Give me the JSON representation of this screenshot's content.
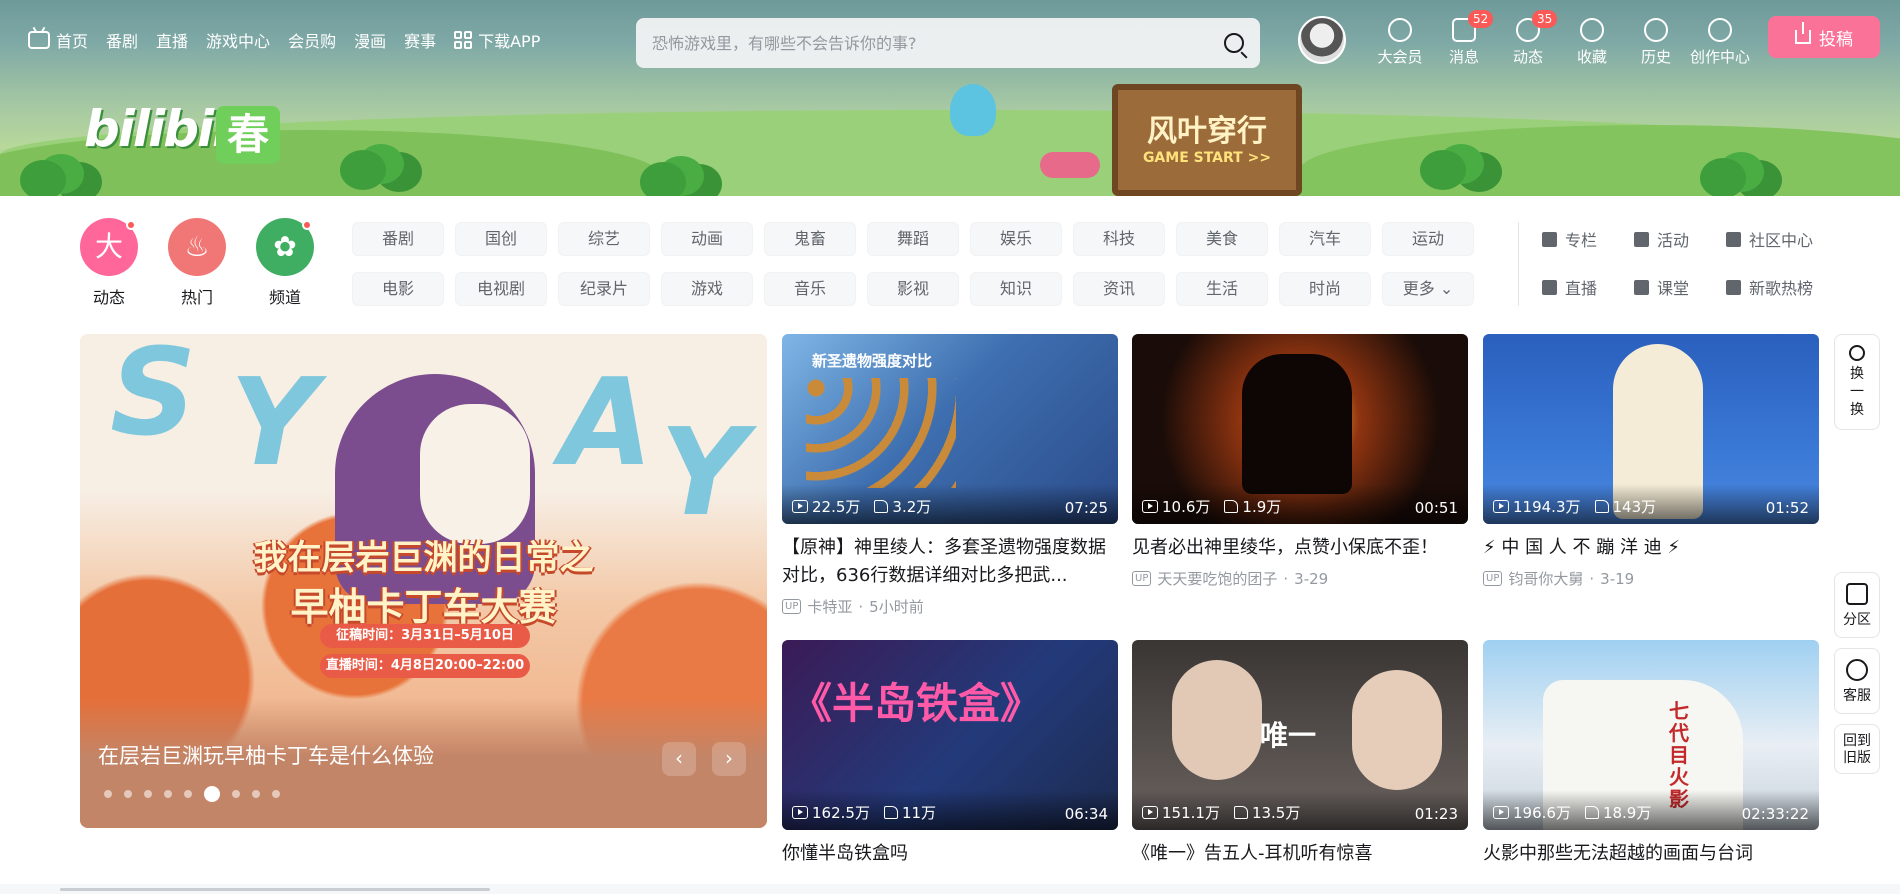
{
  "nav": {
    "left": [
      "首页",
      "番剧",
      "直播",
      "游戏中心",
      "会员购",
      "漫画",
      "赛事",
      "下载APP"
    ],
    "search_placeholder": "恐怖游戏里，有哪些不会告诉你的事?",
    "right": [
      {
        "label": "大会员",
        "icon": "vip-icon",
        "badge": ""
      },
      {
        "label": "消息",
        "icon": "message-icon",
        "badge": "52"
      },
      {
        "label": "动态",
        "icon": "dynamic-icon",
        "badge": "35"
      },
      {
        "label": "收藏",
        "icon": "star-icon",
        "badge": ""
      },
      {
        "label": "历史",
        "icon": "clock-icon",
        "badge": ""
      },
      {
        "label": "创作中心",
        "icon": "bulb-icon",
        "badge": ""
      }
    ],
    "upload": "投稿"
  },
  "banner": {
    "logo": "bilibili",
    "logo_badge": "春",
    "sign_title": "风叶穿行",
    "sign_sub": "GAME START >>"
  },
  "channels": {
    "big": [
      {
        "label": "动态",
        "glyph": "大",
        "color": "#ff6699",
        "dot": true
      },
      {
        "label": "热门",
        "glyph": "♨",
        "color": "#f07775",
        "dot": false
      },
      {
        "label": "频道",
        "glyph": "✿",
        "color": "#40ae62",
        "dot": true
      }
    ],
    "tags": [
      "番剧",
      "国创",
      "综艺",
      "动画",
      "鬼畜",
      "舞蹈",
      "娱乐",
      "科技",
      "美食",
      "汽车",
      "运动",
      "电影",
      "电视剧",
      "纪录片",
      "游戏",
      "音乐",
      "影视",
      "知识",
      "资讯",
      "生活",
      "时尚",
      "更多 ⌄"
    ],
    "links": [
      "专栏",
      "活动",
      "社区中心",
      "直播",
      "课堂",
      "新歌热榜"
    ]
  },
  "carousel": {
    "headline1": "我在层岩巨渊的日常之",
    "headline2": "早柚卡丁车大赛",
    "pill1": "征稿时间：3月31日–5月10日",
    "pill2": "直播时间：4月8日20:00–22:00",
    "title": "在层岩巨渊玩早柚卡丁车是什么体验",
    "slide_count": 9,
    "active_slide": 6
  },
  "videos": [
    {
      "thumb_text": "新圣遗物强度对比",
      "views": "22.5万",
      "likes": "3.2万",
      "duration": "07:25",
      "title": "【原神】神里绫人：多套圣遗物强度数据对比，636行数据详细对比多把武...",
      "up": "卡特亚",
      "date": "5小时前"
    },
    {
      "thumb_text": "",
      "views": "10.6万",
      "likes": "1.9万",
      "duration": "00:51",
      "title": "见者必出神里绫华，点赞小保底不歪！",
      "up": "天天要吃饱的团子",
      "date": "3-29"
    },
    {
      "thumb_text": "",
      "views": "1194.3万",
      "likes": "143万",
      "duration": "01:52",
      "title": "⚡ 中 国 人 不 蹦 洋 迪 ⚡",
      "up": "钧哥你大舅",
      "date": "3-19"
    },
    {
      "thumb_text": "《半岛铁盒》",
      "views": "162.5万",
      "likes": "11万",
      "duration": "06:34",
      "title": "你懂半岛铁盒吗",
      "up": "",
      "date": ""
    },
    {
      "thumb_text": "唯一",
      "views": "151.1万",
      "likes": "13.5万",
      "duration": "01:23",
      "title": "《唯一》告五人-耳机听有惊喜",
      "up": "",
      "date": ""
    },
    {
      "thumb_text": "七代目火影",
      "views": "196.6万",
      "likes": "18.9万",
      "duration": "02:33:22",
      "title": "火影中那些无法超越的画面与台词",
      "up": "",
      "date": ""
    }
  ],
  "side": {
    "refresh": "换一换",
    "zone": "分区",
    "service": "客服",
    "old": "回到旧版"
  }
}
